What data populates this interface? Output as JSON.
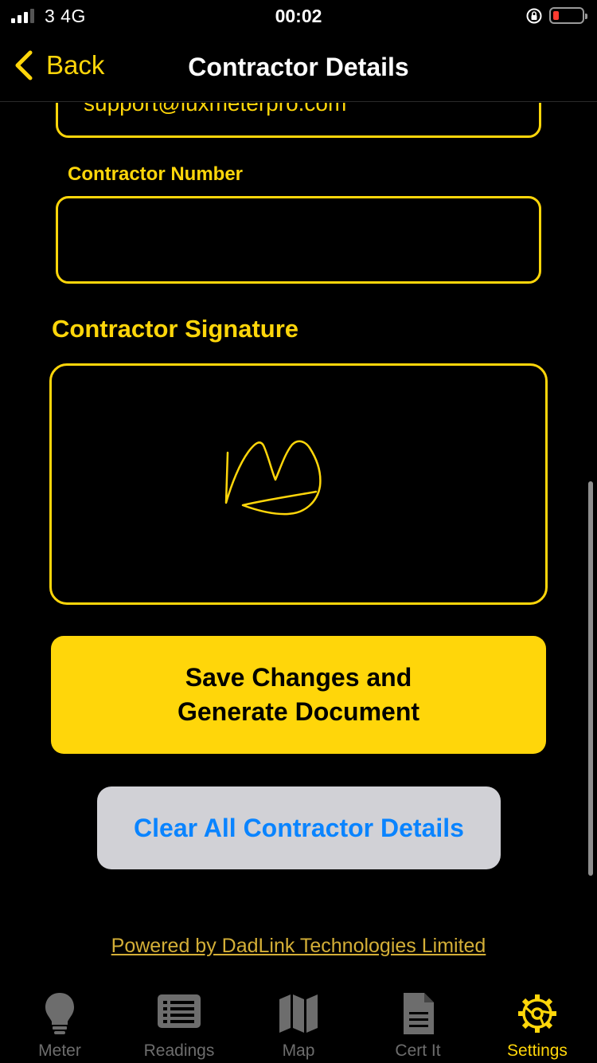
{
  "status_bar": {
    "carrier": "3   4G",
    "time": "00:02",
    "battery_level": 0.2
  },
  "nav": {
    "back_label": "Back",
    "title": "Contractor Details"
  },
  "form": {
    "email_value": "support@luxmeterpro.com",
    "contractor_number_label": "Contractor Number",
    "contractor_number_value": "",
    "signature_heading": "Contractor Signature"
  },
  "actions": {
    "save_label": "Save Changes and Generate Document",
    "clear_label": "Clear All Contractor Details"
  },
  "footer": {
    "powered_by": "Powered by DadLink Technologies Limited"
  },
  "tabs": [
    {
      "label": "Meter",
      "icon": "lightbulb-icon",
      "active": false
    },
    {
      "label": "Readings",
      "icon": "list-icon",
      "active": false
    },
    {
      "label": "Map",
      "icon": "map-icon",
      "active": false
    },
    {
      "label": "Cert It",
      "icon": "document-icon",
      "active": false
    },
    {
      "label": "Settings",
      "icon": "gear-icon",
      "active": true
    }
  ],
  "colors": {
    "accent": "#ffd60a",
    "background": "#000000",
    "link_blue": "#0a84ff",
    "inactive_tab": "#6d6d6d"
  }
}
